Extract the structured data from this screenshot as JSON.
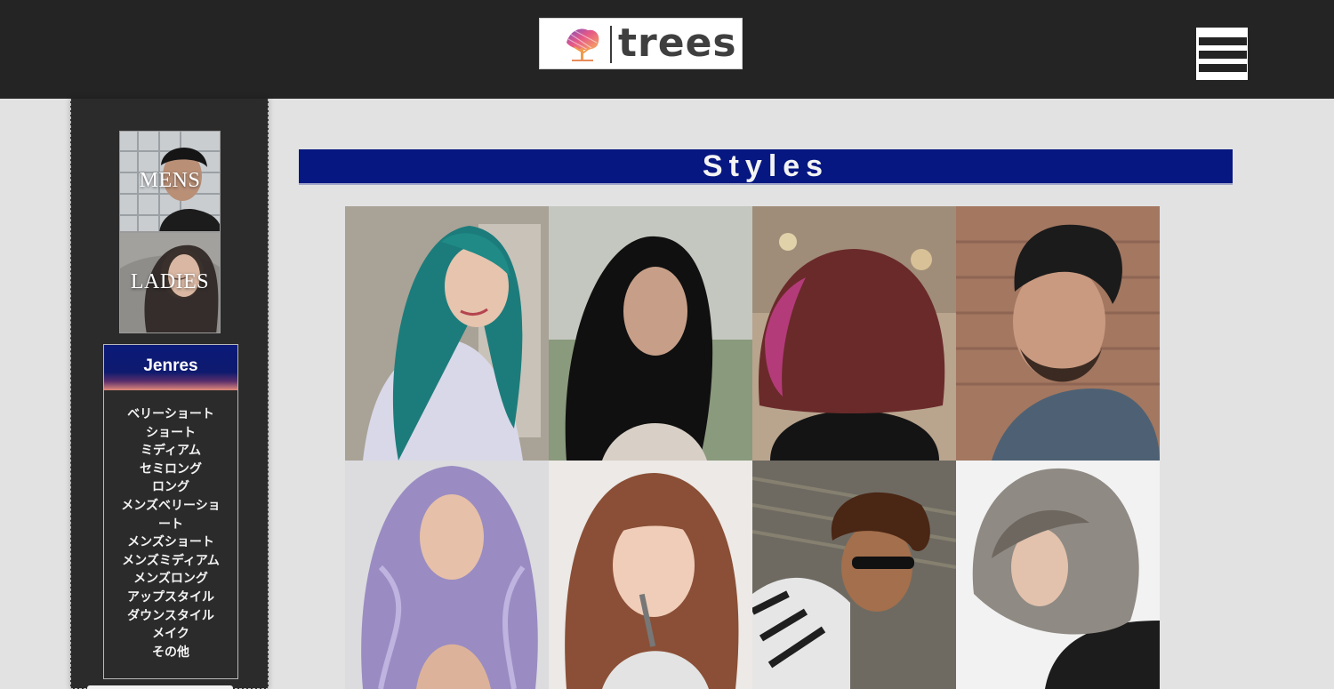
{
  "header": {
    "logo_text": "trees",
    "menu_icon": "hamburger-menu-icon"
  },
  "sidebar": {
    "categories": [
      {
        "label": "MENS"
      },
      {
        "label": "LADIES"
      }
    ],
    "jenres_title": "Jenres",
    "jenres_items": [
      "ベリーショート",
      "ショート",
      "ミディアム",
      "セミロング",
      "ロング",
      "メンズベリーショ",
      "ート",
      "メンズショート",
      "メンズミディアム",
      "メンズロング",
      "アップスタイル",
      "ダウンスタイル",
      "メイク",
      "その他"
    ]
  },
  "main": {
    "section_title": "Styles",
    "gallery": [
      {
        "name": "teal-long-hair"
      },
      {
        "name": "black-long-hair"
      },
      {
        "name": "burgundy-bob"
      },
      {
        "name": "mens-pompadour"
      },
      {
        "name": "lavender-wavy-hair"
      },
      {
        "name": "brown-bangs-hair"
      },
      {
        "name": "mens-curly-hair"
      },
      {
        "name": "ash-bob"
      }
    ]
  },
  "colors": {
    "header_bg": "#242424",
    "page_bg": "#e2e2e2",
    "sidebar_bg": "#2b2b2b",
    "accent_navy": "#061782"
  }
}
